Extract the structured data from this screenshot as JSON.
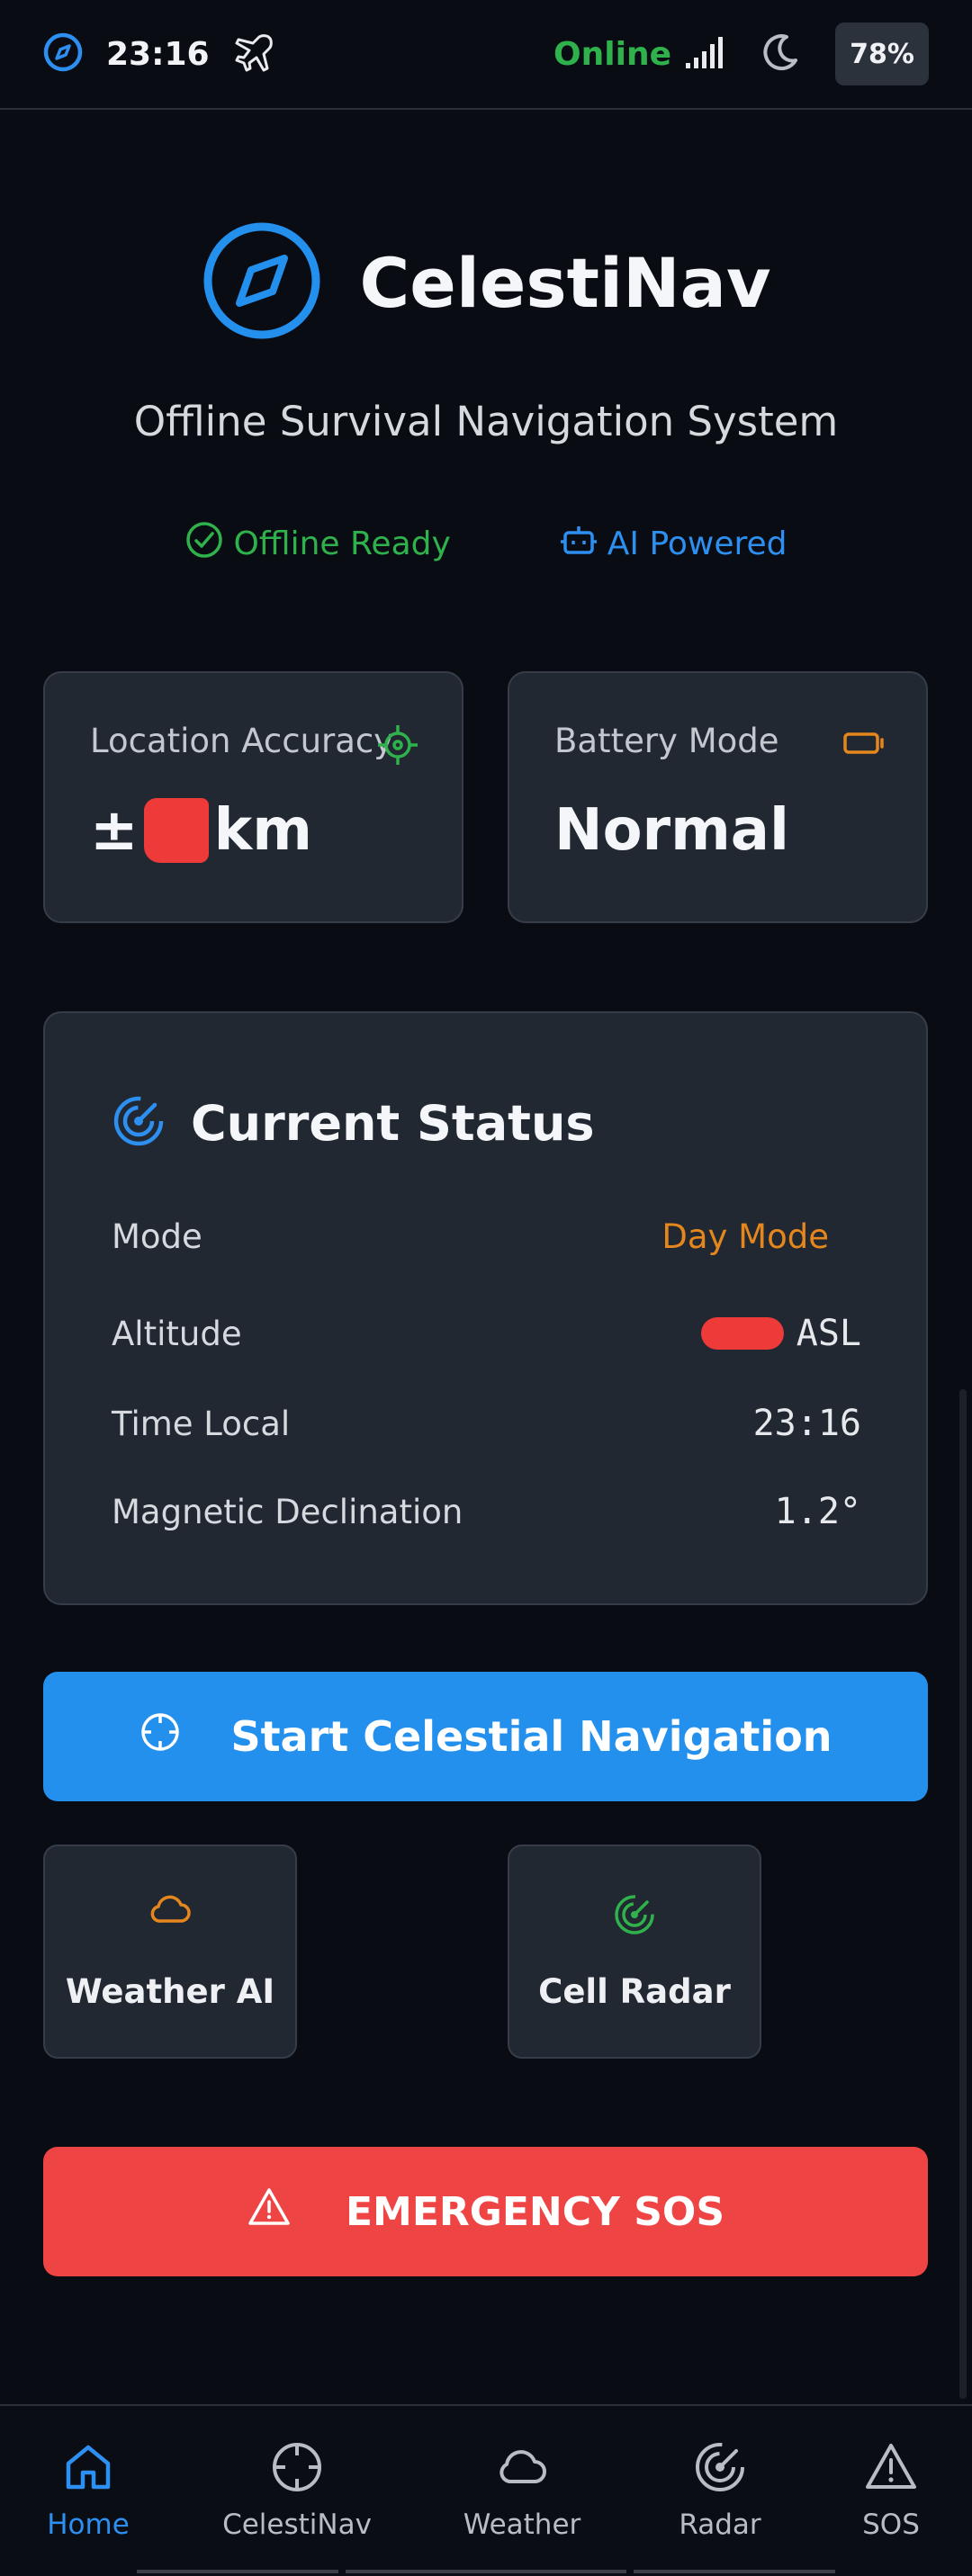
{
  "statusbar": {
    "time": "23:16",
    "online": "Online",
    "battery": "78%"
  },
  "header": {
    "title": "CelestiNav",
    "subtitle": "Offline Survival Navigation System",
    "badge_offline": "Offline Ready",
    "badge_ai": "AI Powered"
  },
  "cards": {
    "location": {
      "label": "Location Accuracy",
      "prefix": "±",
      "unit": "km"
    },
    "battery": {
      "label": "Battery Mode",
      "value": "Normal"
    }
  },
  "status": {
    "title": "Current Status",
    "rows": [
      {
        "label": "Mode",
        "value": "Day Mode"
      },
      {
        "label": "Altitude",
        "value": "ASL"
      },
      {
        "label": "Time Local",
        "value": "23:16"
      },
      {
        "label": "Magnetic Declination",
        "value": "1.2°"
      }
    ]
  },
  "actions": {
    "start": "Start Celestial Navigation",
    "weather": "Weather AI",
    "radar": "Cell Radar",
    "sos": "EMERGENCY SOS"
  },
  "nav": [
    {
      "label": "Home"
    },
    {
      "label": "CelestiNav"
    },
    {
      "label": "Weather"
    },
    {
      "label": "Radar"
    },
    {
      "label": "SOS"
    }
  ],
  "colors": {
    "background": "#0a0c14",
    "card": "#212832",
    "accent_blue": "#2490ee",
    "success_green": "#2fb24c",
    "warning_orange": "#e5871c",
    "danger_red": "#ef4444"
  },
  "icons": [
    "compass-icon",
    "airplane-icon",
    "signal-icon",
    "moon-icon",
    "check-circle-icon",
    "bot-icon",
    "crosshair-icon",
    "battery-icon",
    "radar-icon",
    "cloud-icon",
    "warning-icon",
    "home-icon"
  ]
}
